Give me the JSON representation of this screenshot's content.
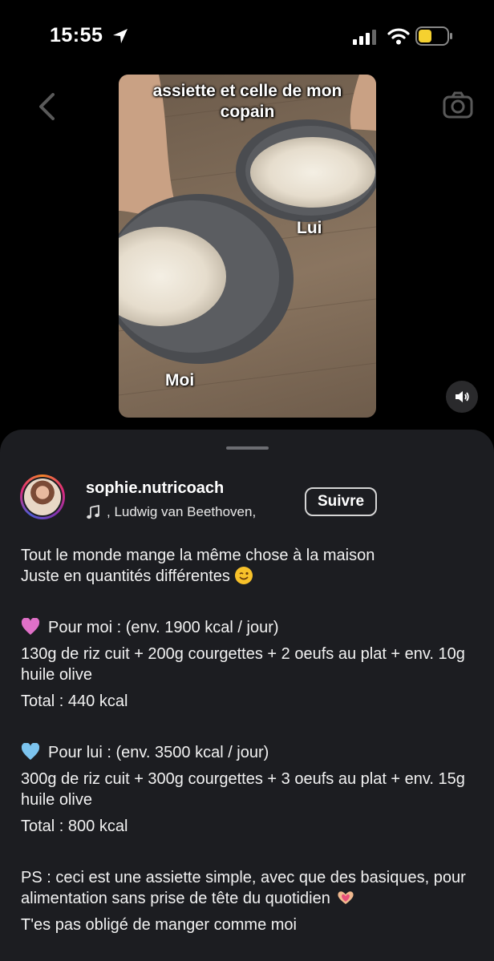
{
  "status_bar": {
    "time": "15:55"
  },
  "video": {
    "overlay_top": "assiette et celle de mon copain",
    "label_lui": "Lui",
    "label_moi": "Moi"
  },
  "post": {
    "username": "sophie.nutricoach",
    "music": ", Ludwig van Beethoven,",
    "follow_label": "Suivre"
  },
  "caption": {
    "line1": "Tout le monde mange la même chose à la maison",
    "line2": "Juste en quantités différentes",
    "moi_heading": "Pour moi : (env. 1900 kcal / jour)",
    "moi_detail": "130g de riz cuit + 200g courgettes + 2 oeufs au plat + env. 10g huile olive",
    "moi_total": "Total : 440 kcal",
    "lui_heading": "Pour lui : (env. 3500 kcal / jour)",
    "lui_detail": "300g de riz cuit + 300g courgettes + 3 oeufs au plat + env. 15g huile olive",
    "lui_total": "Total : 800 kcal",
    "ps": "PS : ceci est une assiette simple, avec que des basiques, pour alimentation sans prise de tête du quotidien",
    "cutoff": "T'es pas obligé de manger comme moi"
  },
  "colors": {
    "sheet": "#1c1d21",
    "heart_pink": "#e070c8",
    "heart_blue": "#7cc4ef"
  }
}
